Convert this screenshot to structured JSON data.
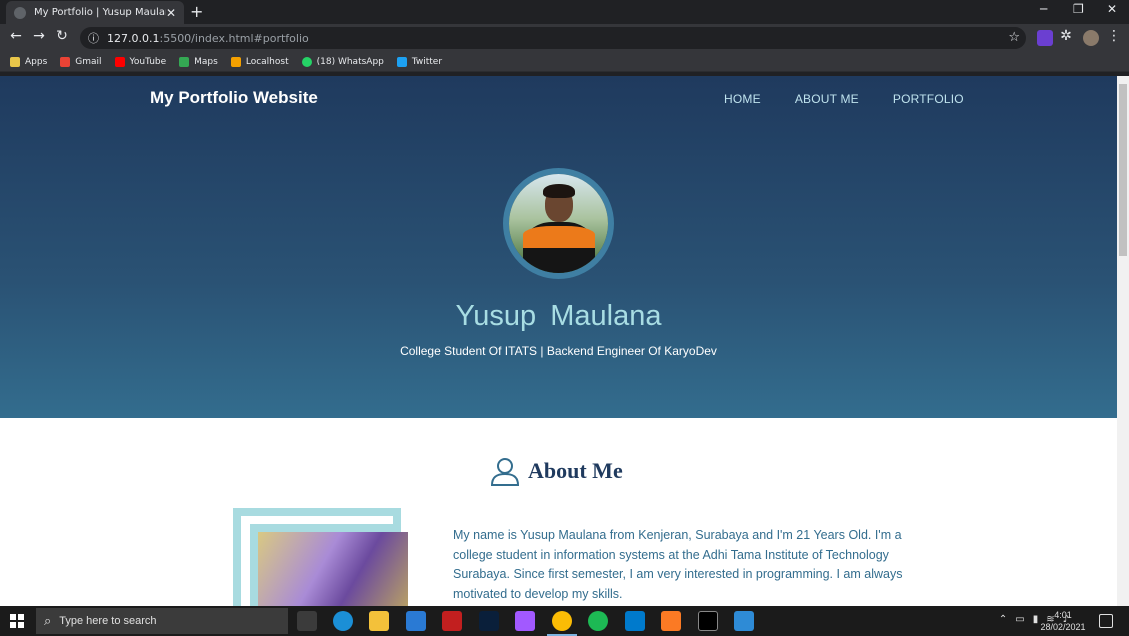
{
  "browser": {
    "tab_title": "My Portfolio | Yusup Maulana",
    "url_host": "127.0.0.1",
    "url_path": ":5500/index.html#portfolio",
    "bookmarks": [
      {
        "label": "Apps",
        "color": "#e8eaed"
      },
      {
        "label": "Gmail",
        "color": "#ea4335"
      },
      {
        "label": "YouTube",
        "color": "#ff0000"
      },
      {
        "label": "Maps",
        "color": "#34a853"
      },
      {
        "label": "Localhost",
        "color": "#f4a000"
      },
      {
        "label": "(18) WhatsApp",
        "color": "#25d366"
      },
      {
        "label": "Twitter",
        "color": "#1da1f2"
      }
    ]
  },
  "site": {
    "brand": "My Portfolio Website",
    "nav": [
      "HOME",
      "ABOUT ME",
      "PORTFOLIO"
    ],
    "hero_name": "Yusup Maulana",
    "hero_subtitle": "College Student Of ITATS | Backend Engineer Of KaryoDev",
    "about_title": "About Me",
    "about_text": "My name is Yusup Maulana from Kenjeran, Surabaya and I'm 21 Years Old. I'm a college student in information systems at the Adhi Tama Institute of Technology Surabaya. Since first semester, I am very interested in programming. I am always motivated to develop my skills."
  },
  "taskbar": {
    "search_placeholder": "Type here to search",
    "time": "4:01",
    "date": "28/02/2021"
  }
}
